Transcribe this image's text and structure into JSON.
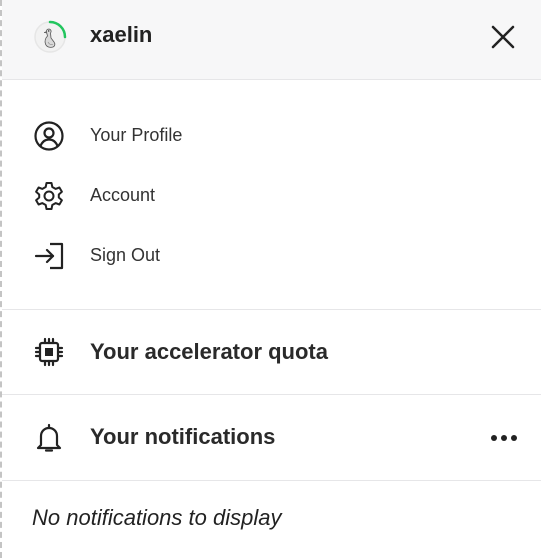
{
  "header": {
    "username": "xaelin",
    "avatar_icon": "goose-avatar-icon",
    "close_icon": "close-icon"
  },
  "menu": {
    "items": [
      {
        "label": "Your Profile",
        "icon": "user-circle-icon"
      },
      {
        "label": "Account",
        "icon": "gear-icon"
      },
      {
        "label": "Sign Out",
        "icon": "sign-out-icon"
      }
    ]
  },
  "quota": {
    "title": "Your accelerator quota",
    "icon": "chip-icon"
  },
  "notifications": {
    "title": "Your notifications",
    "icon": "bell-icon",
    "more_icon": "more-horizontal-icon",
    "empty_message": "No notifications to display"
  },
  "colors": {
    "accent_ring": "#22c55e",
    "header_bg": "#f7f7f8"
  }
}
